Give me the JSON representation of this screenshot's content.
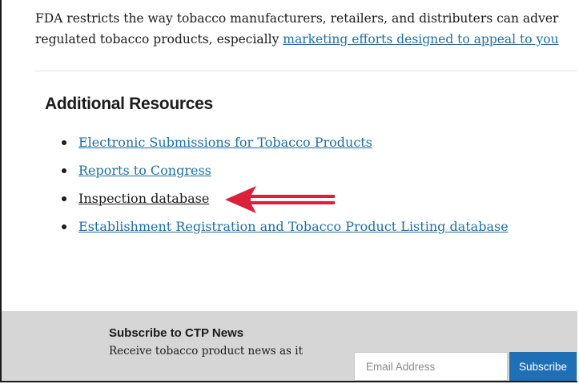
{
  "intro": {
    "line1": "FDA restricts the way tobacco manufacturers, retailers, and distributers can adver",
    "line2_prefix": "regulated tobacco products, especially ",
    "line2_link": "marketing efforts designed to appeal to you"
  },
  "resources": {
    "heading": "Additional Resources",
    "items": [
      {
        "label": "Electronic Submissions for Tobacco Products"
      },
      {
        "label": "Reports to Congress"
      },
      {
        "label": "Inspection database"
      },
      {
        "label": "Establishment Registration and Tobacco Product Listing database"
      }
    ]
  },
  "footer": {
    "title": "Subscribe to CTP News",
    "text": "Receive tobacco product news as it",
    "email_placeholder": "Email Address",
    "subscribe_label": "Subscribe"
  },
  "colors": {
    "link": "#1a6fb0",
    "arrow": "#d9213c",
    "button": "#1f6fb6",
    "footer_bg": "#d6d6d6"
  }
}
